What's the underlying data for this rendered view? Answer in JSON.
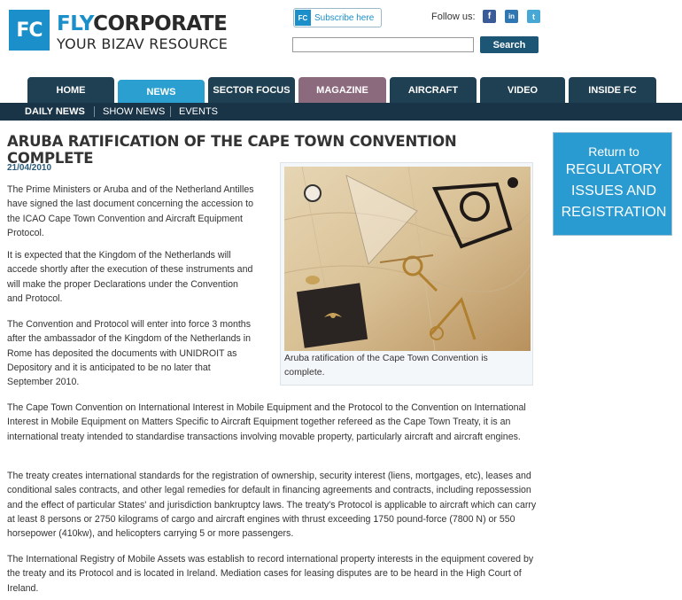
{
  "header": {
    "logo_mark": "FC",
    "brand_fly": "FLY",
    "brand_corporate": "CORPORATE",
    "tagline": "YOUR BIZAV RESOURCE",
    "subscribe_mark": "FC",
    "subscribe_label": "Subscribe here",
    "follow_label": "Follow us:",
    "social": {
      "facebook": "f",
      "linkedin": "in",
      "twitter": "t"
    },
    "search_placeholder": "",
    "search_button": "Search"
  },
  "nav": {
    "tabs": [
      "HOME",
      "NEWS",
      "SECTOR FOCUS",
      "MAGAZINE",
      "AIRCRAFT",
      "VIDEO",
      "INSIDE FC"
    ],
    "active_tab": "NEWS",
    "subtabs": [
      "DAILY NEWS",
      "SHOW NEWS",
      "EVENTS"
    ],
    "active_subtab": "DAILY NEWS"
  },
  "article": {
    "title": "ARUBA RATIFICATION OF THE CAPE TOWN CONVENTION COMPLETE",
    "date": "21/04/2010",
    "paragraphs": [
      "The Prime Ministers or Aruba and of the Netherland Antilles have signed the last document concerning the accession to the ICAO Cape Town Convention and Aircraft Equipment Protocol.",
      "It is expected that the Kingdom of the Netherlands will accede shortly after the execution of these instruments and will make the proper Declarations under the Convention and Protocol.",
      "The Convention and Protocol will enter into force 3 months after the ambassador of the Kingdom of the Netherlands in Rome has deposited the documents with UNIDROIT as Depository and it is anticipated to be no later that September 2010.",
      "The Cape Town Convention on International Interest in Mobile Equipment and the Protocol to the Convention on International Interest in Mobile Equipment on Matters Specific to Aircraft Equipment together refereed as  the Cape Town Treaty, it is an international treaty intended to standardise transactions involving movable property, particularly aircraft and aircraft engines.",
      "The treaty creates international standards for the registration of ownership, security interest (liens, mortgages, etc), leases and conditional sales contracts, and other legal remedies for default in financing agreements and contracts, including repossession and the effect of particular States' and jurisdiction bankruptcy laws. The treaty's Protocol is applicable to aircraft which can carry at least 8 persons or 2750 kilograms of cargo and aircraft engines with thrust exceeding 1750 pound-force (7800 N) or 550 horsepower (410kw), and helicopters carrying 5 or more passengers.",
      "The International Registry of Mobile Assets was establish to record international property interests in the equipment covered by the treaty and its Protocol and is located in Ireland. Mediation cases for leasing disputes are to be heard in the High Court of Ireland."
    ],
    "image_caption": "Aruba ratification of the Cape Town Convention is complete."
  },
  "sidebar": {
    "return_label": "Return to",
    "section_line1": "REGULATORY",
    "section_line2": "ISSUES AND",
    "section_line3": "REGISTRATION"
  },
  "colors": {
    "brand_blue": "#1a8fc9",
    "nav_dark": "#1f3f52",
    "nav_active": "#2b9fcf",
    "magazine": "#8c6a7e"
  }
}
